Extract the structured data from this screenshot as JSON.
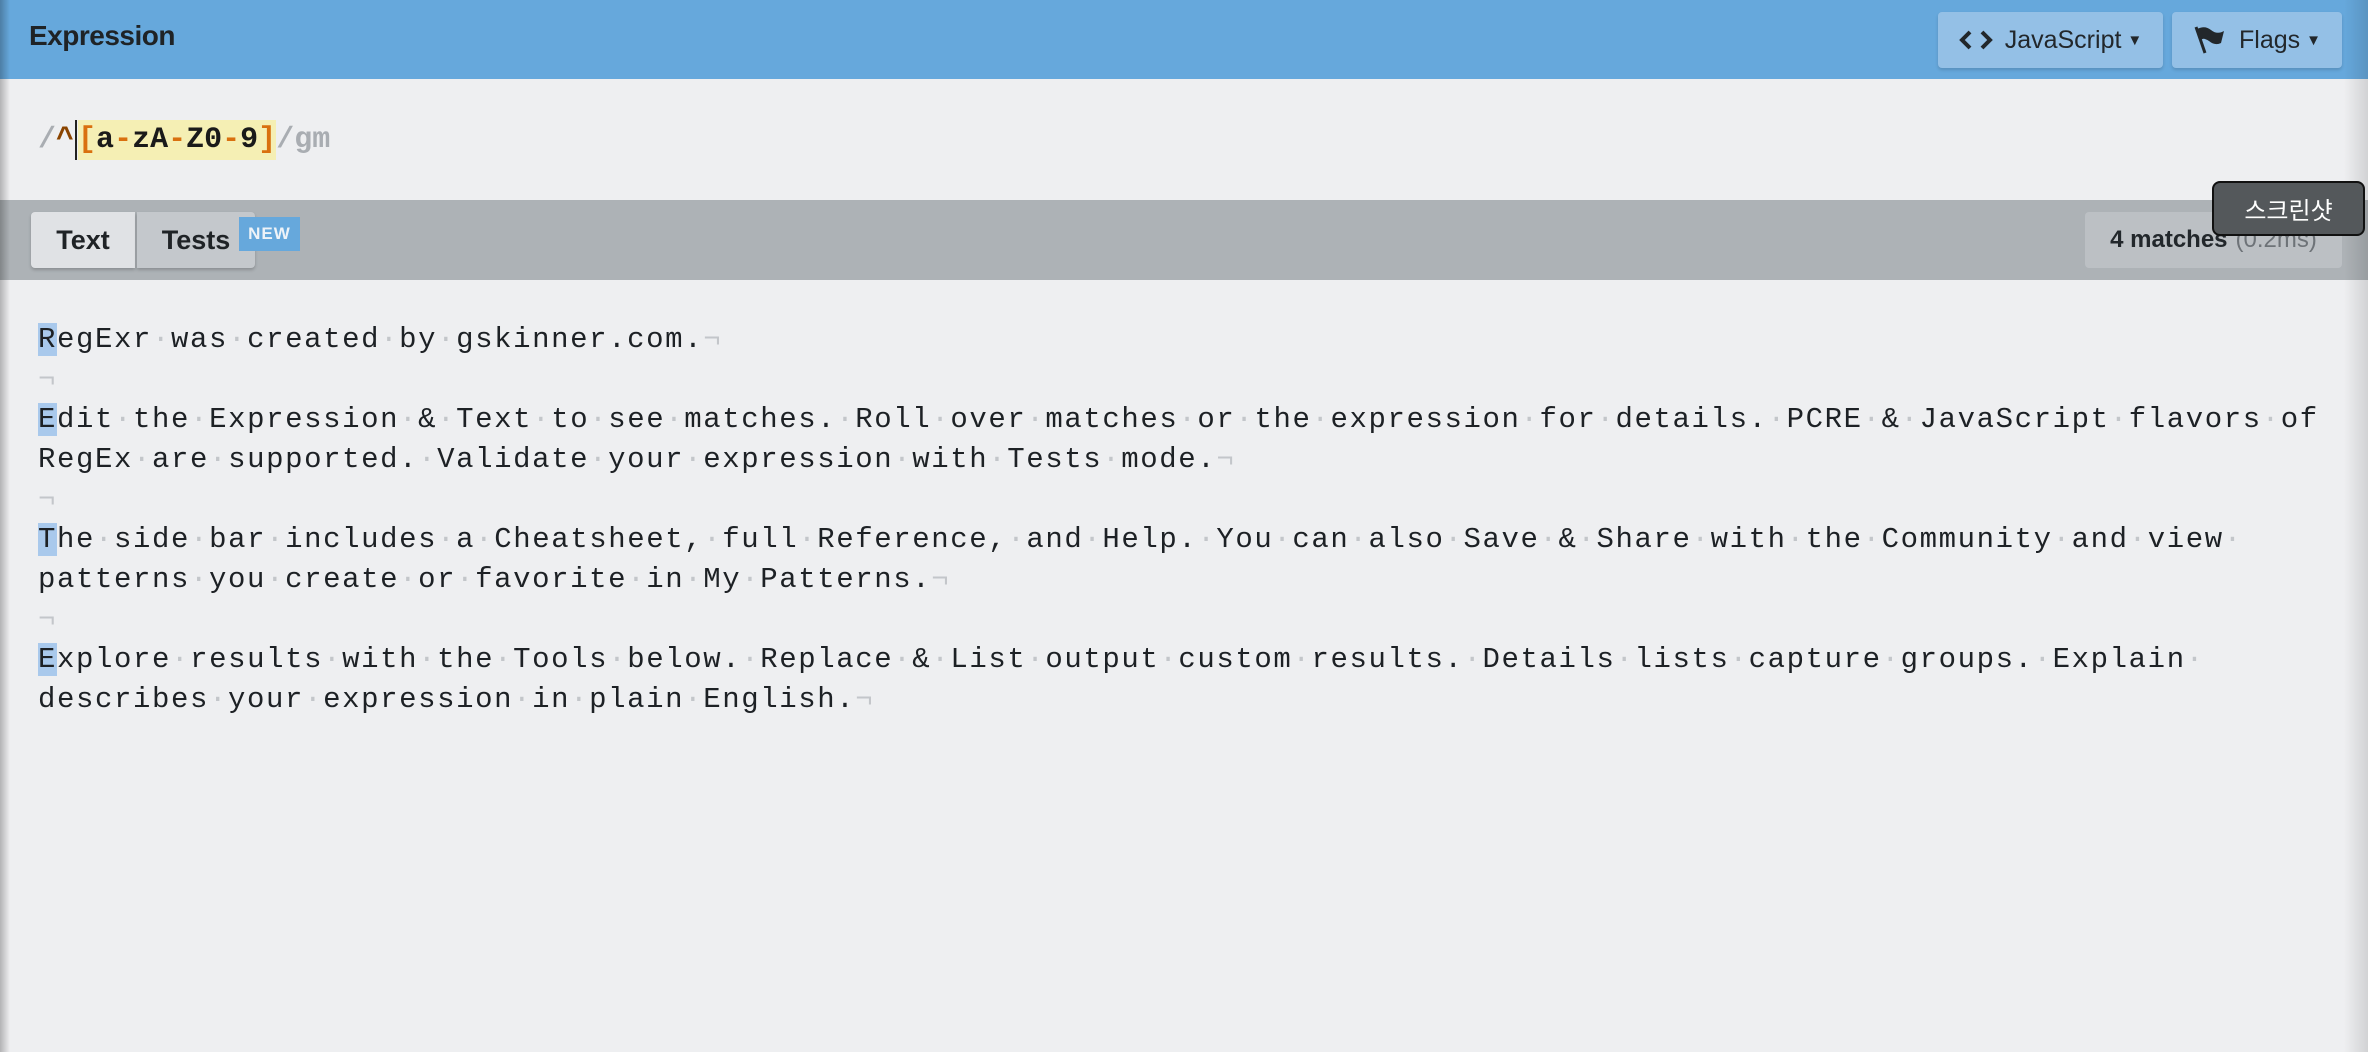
{
  "header": {
    "title": "Expression",
    "language_button": {
      "label": "JavaScript",
      "icon": "code-brackets-icon"
    },
    "flags_button": {
      "label": "Flags",
      "icon": "flag-icon"
    }
  },
  "expression": {
    "open_delimiter": "/",
    "anchor": "^",
    "set_open": "[",
    "range1_start": "a",
    "range1_dash": "-",
    "range1_end": "z",
    "range2_start": "A",
    "range2_dash": "-",
    "range2_end": "Z",
    "range3_start": "0",
    "range3_dash": "-",
    "range3_end": "9",
    "set_close": "]",
    "close_delimiter": "/",
    "flags": "gm"
  },
  "tabs": [
    {
      "label": "Text",
      "active": true
    },
    {
      "label": "Tests",
      "badge": "NEW"
    }
  ],
  "status": {
    "matches": "4 matches",
    "time": "(0.2ms)"
  },
  "tooltip": "스크린샷",
  "colors": {
    "header": "#66a8dc",
    "match_highlight": "#a9c9ec",
    "set_highlight": "#f5efb4",
    "range_token": "#d9700f"
  },
  "text": {
    "eol_marker": "¬",
    "lines": [
      {
        "text": "RegExr was created by gskinner.com.",
        "match_first": true,
        "eol": true
      },
      {
        "text": "",
        "eol": true
      },
      {
        "text": "Edit the Expression & Text to see matches. Roll over matches or the expression for details. PCRE & JavaScript flavors of",
        "match_first": true,
        "eol": false
      },
      {
        "text": "RegEx are supported. Validate your expression with Tests mode.",
        "eol": true
      },
      {
        "text": "",
        "eol": true
      },
      {
        "text": "The side bar includes a Cheatsheet, full Reference, and Help. You can also Save & Share with the Community and view ",
        "match_first": true,
        "eol": false
      },
      {
        "text": "patterns you create or favorite in My Patterns.",
        "eol": true
      },
      {
        "text": "",
        "eol": true
      },
      {
        "text": "Explore results with the Tools below. Replace & List output custom results. Details lists capture groups. Explain ",
        "match_first": true,
        "eol": false
      },
      {
        "text": "describes your expression in plain English.",
        "eol": true
      }
    ]
  }
}
